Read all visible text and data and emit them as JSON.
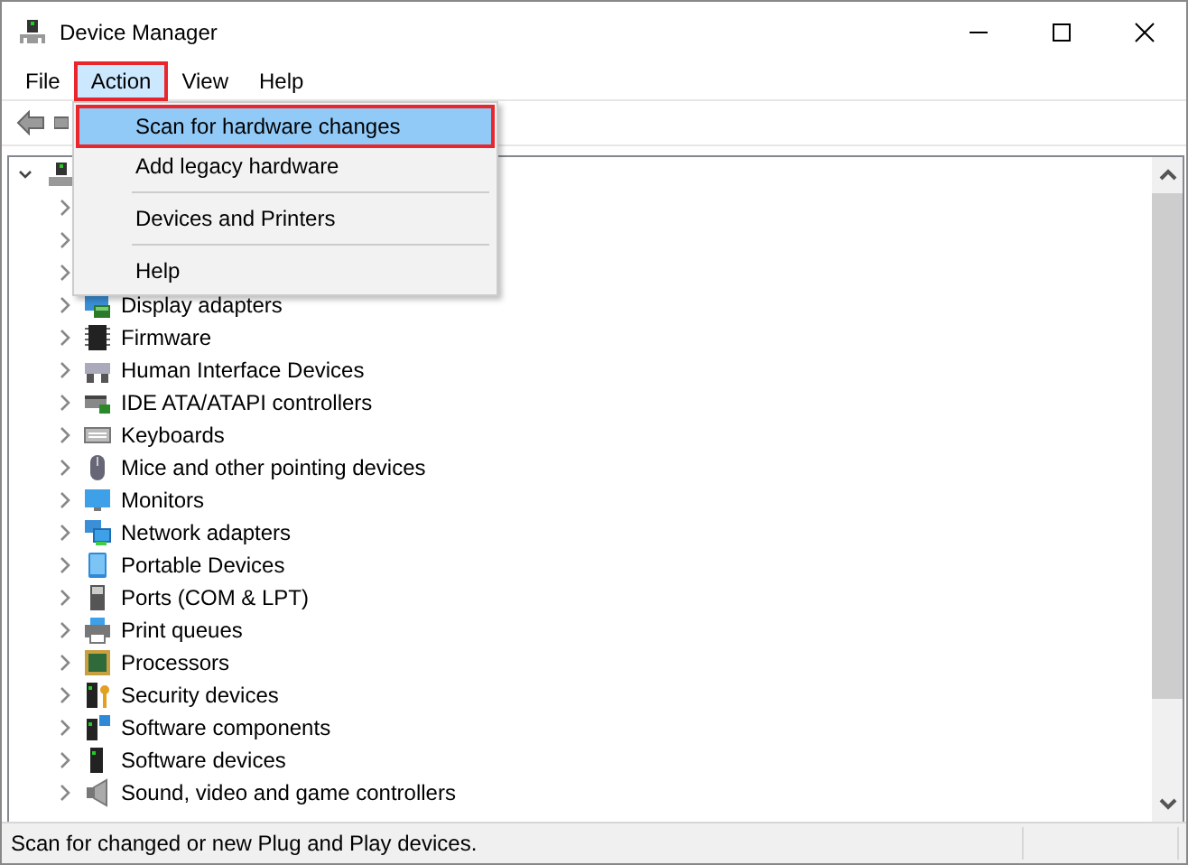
{
  "window": {
    "title": "Device Manager"
  },
  "menu_bar": [
    {
      "label": "File",
      "selected": false,
      "annotated": false
    },
    {
      "label": "Action",
      "selected": true,
      "annotated": true
    },
    {
      "label": "View",
      "selected": false,
      "annotated": false
    },
    {
      "label": "Help",
      "selected": false,
      "annotated": false
    }
  ],
  "action_menu": [
    {
      "kind": "item",
      "label": "Scan for hardware changes",
      "selected": true,
      "annotated": true
    },
    {
      "kind": "item",
      "label": "Add legacy hardware",
      "selected": false,
      "annotated": false
    },
    {
      "kind": "separator"
    },
    {
      "kind": "item",
      "label": "Devices and Printers",
      "selected": false,
      "annotated": false
    },
    {
      "kind": "separator"
    },
    {
      "kind": "item",
      "label": "Help",
      "selected": false,
      "annotated": false
    }
  ],
  "tree": {
    "expanded": true,
    "children": [
      {
        "expanded": false
      },
      {
        "expanded": false
      },
      {
        "expanded": false
      },
      {
        "label": "Display adapters",
        "expanded": false
      },
      {
        "label": "Firmware",
        "expanded": false
      },
      {
        "label": "Human Interface Devices",
        "expanded": false
      },
      {
        "label": "IDE ATA/ATAPI controllers",
        "expanded": false
      },
      {
        "label": "Keyboards",
        "expanded": false
      },
      {
        "label": "Mice and other pointing devices",
        "expanded": false
      },
      {
        "label": "Monitors",
        "expanded": false
      },
      {
        "label": "Network adapters",
        "expanded": false
      },
      {
        "label": "Portable Devices",
        "expanded": false
      },
      {
        "label": "Ports (COM & LPT)",
        "expanded": false
      },
      {
        "label": "Print queues",
        "expanded": false
      },
      {
        "label": "Processors",
        "expanded": false
      },
      {
        "label": "Security devices",
        "expanded": false
      },
      {
        "label": "Software components",
        "expanded": false
      },
      {
        "label": "Software devices",
        "expanded": false
      },
      {
        "label": "Sound, video and game controllers",
        "expanded": false
      }
    ]
  },
  "status_bar": {
    "text": "Scan for changed or new Plug and Play devices."
  }
}
